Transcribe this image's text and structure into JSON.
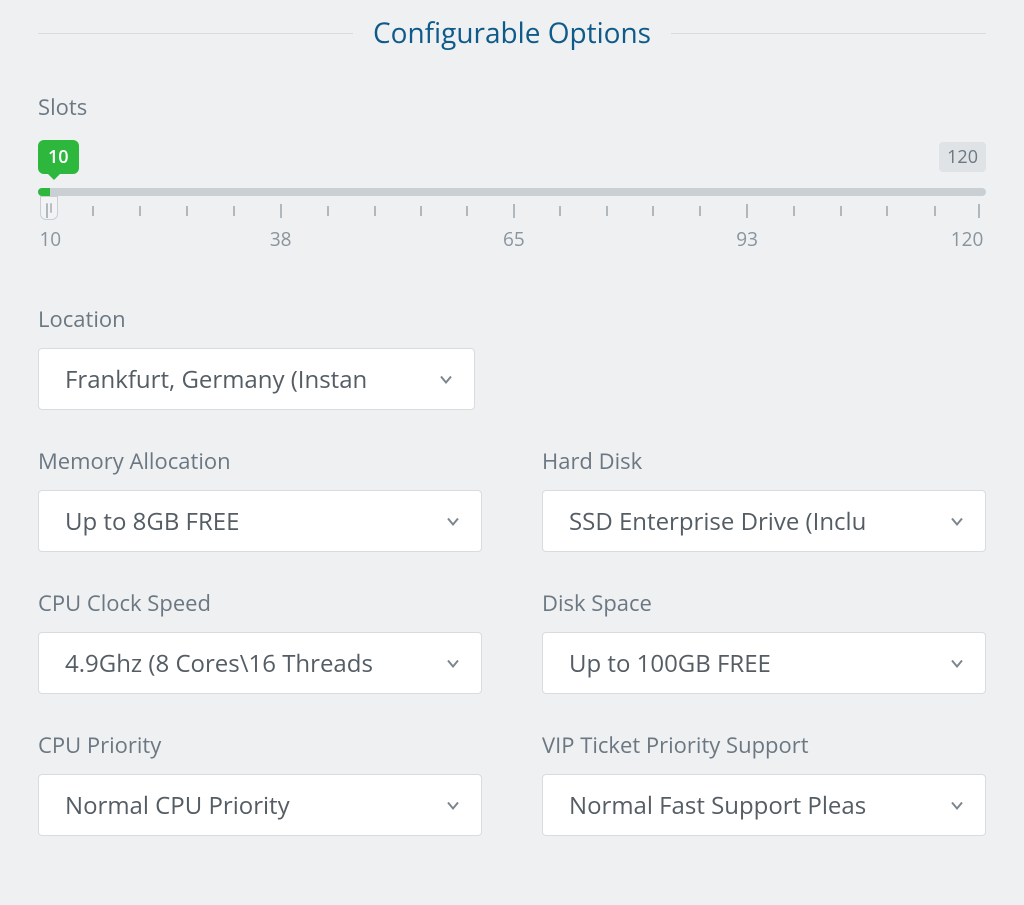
{
  "heading": "Configurable Options",
  "slots": {
    "label": "Slots",
    "min_value": "10",
    "max_value": "120",
    "scale_labels": [
      "10",
      "38",
      "65",
      "93",
      "120"
    ]
  },
  "fields": {
    "location": {
      "label": "Location",
      "value": "Frankfurt, Germany (Instan"
    },
    "memory": {
      "label": "Memory Allocation",
      "value": "Up to 8GB FREE"
    },
    "hard_disk": {
      "label": "Hard Disk",
      "value": "SSD Enterprise Drive (Inclu"
    },
    "cpu_clock": {
      "label": "CPU Clock Speed",
      "value": "4.9Ghz (8 Cores\\16 Threads"
    },
    "disk_space": {
      "label": "Disk Space",
      "value": "Up to 100GB FREE"
    },
    "cpu_priority": {
      "label": "CPU Priority",
      "value": "Normal CPU Priority"
    },
    "vip_support": {
      "label": "VIP Ticket Priority Support",
      "value": "Normal Fast Support Pleas"
    }
  }
}
